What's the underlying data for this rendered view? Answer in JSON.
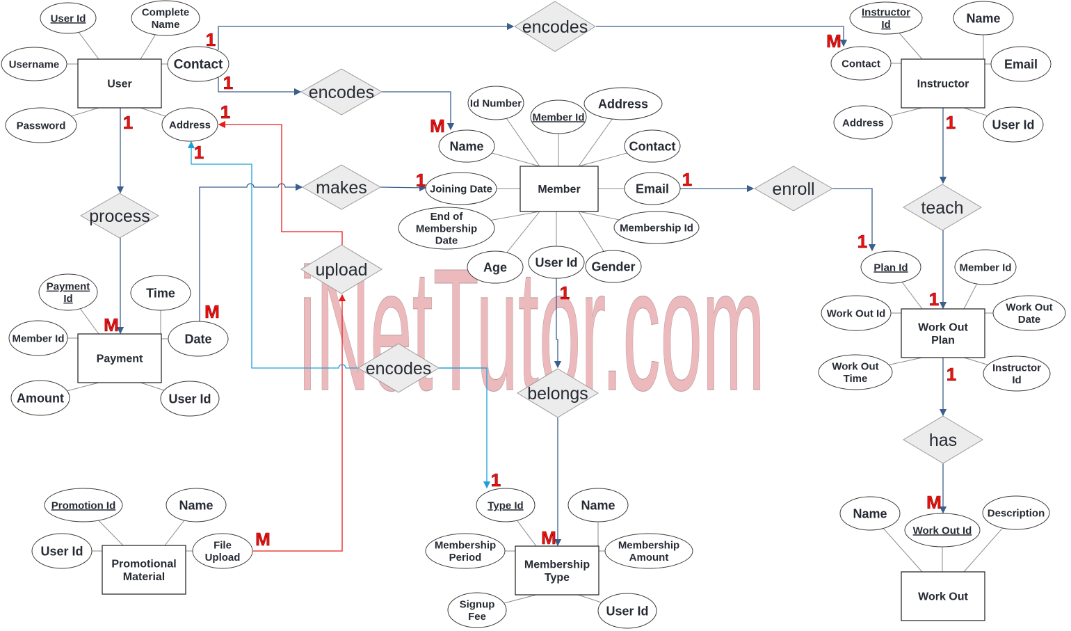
{
  "diagram": {
    "type": "entity-relationship",
    "watermark": "iNetTutor.com",
    "colors": {
      "entity_border": "#1a1a1a",
      "relationship_fill": "#ececec",
      "cardinality": "#ee1111",
      "link_navy": "#3b5f8c",
      "link_red": "#e81c1c",
      "link_cyan": "#1ea0d8",
      "watermark": "#e9aeb2"
    },
    "entities": [
      {
        "id": "user",
        "label": "User",
        "attributes": [
          {
            "id": "user-userid",
            "label": "User Id",
            "key": true
          },
          {
            "id": "user-completename",
            "label": "Complete Name",
            "key": false
          },
          {
            "id": "user-username",
            "label": "Username",
            "key": false
          },
          {
            "id": "user-contact",
            "label": "Contact",
            "key": false
          },
          {
            "id": "user-password",
            "label": "Password",
            "key": false
          },
          {
            "id": "user-address",
            "label": "Address",
            "key": false
          }
        ]
      },
      {
        "id": "instructor",
        "label": "Instructor",
        "attributes": [
          {
            "id": "ins-id",
            "label": "Instructor Id",
            "key": true
          },
          {
            "id": "ins-name",
            "label": "Name",
            "key": false
          },
          {
            "id": "ins-contact",
            "label": "Contact",
            "key": false
          },
          {
            "id": "ins-email",
            "label": "Email",
            "key": false
          },
          {
            "id": "ins-address",
            "label": "Address",
            "key": false
          },
          {
            "id": "ins-userid",
            "label": "User Id",
            "key": false
          }
        ]
      },
      {
        "id": "member",
        "label": "Member",
        "attributes": [
          {
            "id": "mem-idnumber",
            "label": "Id Number",
            "key": false
          },
          {
            "id": "mem-memberid",
            "label": "Member Id",
            "key": true
          },
          {
            "id": "mem-address",
            "label": "Address",
            "key": false
          },
          {
            "id": "mem-name",
            "label": "Name",
            "key": false
          },
          {
            "id": "mem-contact",
            "label": "Contact",
            "key": false
          },
          {
            "id": "mem-joining",
            "label": "Joining Date",
            "key": false
          },
          {
            "id": "mem-email",
            "label": "Email",
            "key": false
          },
          {
            "id": "mem-end",
            "label": "End of Membership Date",
            "key": false
          },
          {
            "id": "mem-membershipid",
            "label": "Membership Id",
            "key": false
          },
          {
            "id": "mem-age",
            "label": "Age",
            "key": false
          },
          {
            "id": "mem-userid",
            "label": "User Id",
            "key": false
          },
          {
            "id": "mem-gender",
            "label": "Gender",
            "key": false
          }
        ]
      },
      {
        "id": "payment",
        "label": "Payment",
        "attributes": [
          {
            "id": "pay-id",
            "label": "Payment Id",
            "key": true
          },
          {
            "id": "pay-time",
            "label": "Time",
            "key": false
          },
          {
            "id": "pay-memberid",
            "label": "Member Id",
            "key": false
          },
          {
            "id": "pay-date",
            "label": "Date",
            "key": false
          },
          {
            "id": "pay-amount",
            "label": "Amount",
            "key": false
          },
          {
            "id": "pay-userid",
            "label": "User Id",
            "key": false
          }
        ]
      },
      {
        "id": "workoutplan",
        "label": "Work Out Plan",
        "attributes": [
          {
            "id": "wop-planid",
            "label": "Plan Id",
            "key": true
          },
          {
            "id": "wop-memberid",
            "label": "Member Id",
            "key": false
          },
          {
            "id": "wop-workoutid",
            "label": "Work Out Id",
            "key": false
          },
          {
            "id": "wop-date",
            "label": "Work Out Date",
            "key": false
          },
          {
            "id": "wop-time",
            "label": "Work Out Time",
            "key": false
          },
          {
            "id": "wop-instructorid",
            "label": "Instructor Id",
            "key": false
          }
        ]
      },
      {
        "id": "workout",
        "label": "Work Out",
        "attributes": [
          {
            "id": "wo-name",
            "label": "Name",
            "key": false
          },
          {
            "id": "wo-id",
            "label": "Work Out Id",
            "key": true
          },
          {
            "id": "wo-desc",
            "label": "Description",
            "key": false
          }
        ]
      },
      {
        "id": "promo",
        "label": "Promotional Material",
        "attributes": [
          {
            "id": "pm-id",
            "label": "Promotion Id",
            "key": true
          },
          {
            "id": "pm-name",
            "label": "Name",
            "key": false
          },
          {
            "id": "pm-userid",
            "label": "User Id",
            "key": false
          },
          {
            "id": "pm-file",
            "label": "File Upload",
            "key": false
          }
        ]
      },
      {
        "id": "mtype",
        "label": "Membership Type",
        "attributes": [
          {
            "id": "mt-typeid",
            "label": "Type Id",
            "key": true
          },
          {
            "id": "mt-name",
            "label": "Name",
            "key": false
          },
          {
            "id": "mt-period",
            "label": "Membership Period",
            "key": false
          },
          {
            "id": "mt-amount",
            "label": "Membership Amount",
            "key": false
          },
          {
            "id": "mt-fee",
            "label": "Signup Fee",
            "key": false
          },
          {
            "id": "mt-userid",
            "label": "User Id",
            "key": false
          }
        ]
      }
    ],
    "relationships": [
      {
        "id": "rel-encodes-instructor",
        "label": "encodes",
        "from": "User.Contact",
        "to": "Instructor.Contact",
        "from_card": "1",
        "to_card": "M"
      },
      {
        "id": "rel-encodes-member",
        "label": "encodes",
        "from": "User.Contact",
        "to": "Member.Name",
        "from_card": "1",
        "to_card": "M"
      },
      {
        "id": "rel-process",
        "label": "process",
        "from": "User",
        "to": "Payment",
        "from_card": "1",
        "to_card": "M"
      },
      {
        "id": "rel-makes",
        "label": "makes",
        "from": "Payment.Date",
        "to": "Member.Joining Date",
        "from_card": "M",
        "to_card": "1"
      },
      {
        "id": "rel-upload",
        "label": "upload",
        "from": "Promotional Material.File Upload",
        "to": "User.Address",
        "from_card": "M",
        "to_card": "1"
      },
      {
        "id": "rel-encodes-type",
        "label": "encodes",
        "from": "User.Address",
        "to": "Membership Type.Type Id",
        "from_card": "1",
        "to_card": "1"
      },
      {
        "id": "rel-belongs",
        "label": "belongs",
        "from": "Member.User Id",
        "to": "Membership Type",
        "from_card": "1",
        "to_card": "M"
      },
      {
        "id": "rel-enroll",
        "label": "enroll",
        "from": "Member.Email",
        "to": "Work Out Plan.Plan Id",
        "from_card": "1",
        "to_card": "1"
      },
      {
        "id": "rel-teach",
        "label": "teach",
        "from": "Instructor",
        "to": "Work Out Plan",
        "from_card": "1",
        "to_card": "1"
      },
      {
        "id": "rel-has",
        "label": "has",
        "from": "Work Out Plan",
        "to": "Work Out.Work Out Id",
        "from_card": "1",
        "to_card": "M"
      }
    ]
  }
}
